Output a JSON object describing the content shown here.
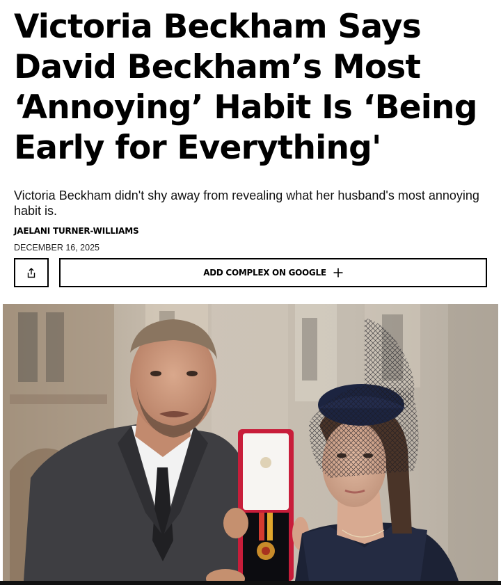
{
  "article": {
    "headline": "Victoria Beckham Says David Beckham’s Most ‘Annoying’ Habit Is ‘Being Early for Everything'",
    "dek": "Victoria Beckham didn't shy away from revealing what her husband's most annoying habit is.",
    "author": "JAELANI TURNER-WILLIAMS",
    "date": "DECEMBER 16, 2025"
  },
  "actions": {
    "share_icon": "share-icon",
    "google_label": "ADD COMPLEX ON GOOGLE",
    "google_icon": "plus-icon"
  },
  "photo": {
    "subject": "David Beckham holding medal case beside Victoria Beckham"
  }
}
